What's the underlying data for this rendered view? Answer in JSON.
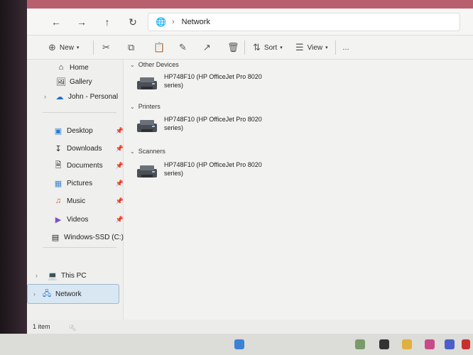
{
  "nav": {
    "back_icon": "arrow-left-icon",
    "forward_icon": "arrow-right-icon",
    "up_icon": "arrow-up-icon",
    "refresh_icon": "refresh-icon",
    "address_text": "Network"
  },
  "toolbar": {
    "new_label": "New",
    "sort_label": "Sort",
    "view_label": "View",
    "more_label": "…"
  },
  "sidebar": {
    "items": [
      {
        "label": "Home",
        "icon": "home-icon"
      },
      {
        "label": "Gallery",
        "icon": "gallery-icon"
      },
      {
        "label": "John - Personal",
        "icon": "cloud-icon"
      },
      {
        "label": "Desktop",
        "icon": "desktop-icon"
      },
      {
        "label": "Downloads",
        "icon": "download-icon"
      },
      {
        "label": "Documents",
        "icon": "documents-icon"
      },
      {
        "label": "Pictures",
        "icon": "pictures-icon"
      },
      {
        "label": "Music",
        "icon": "music-icon"
      },
      {
        "label": "Videos",
        "icon": "videos-icon"
      },
      {
        "label": "Windows-SSD (C:)",
        "icon": "drive-icon"
      },
      {
        "label": "This PC",
        "icon": "pc-icon"
      },
      {
        "label": "Network",
        "icon": "network-icon"
      }
    ]
  },
  "content": {
    "groups": [
      {
        "header": "Other Devices",
        "device": "HP748F10 (HP OfficeJet Pro 8020 series)"
      },
      {
        "header": "Printers",
        "device": "HP748F10 (HP OfficeJet Pro 8020 series)"
      },
      {
        "header": "Scanners",
        "device": "HP748F10 (HP OfficeJet Pro 8020 series)"
      }
    ]
  },
  "status": {
    "item_count": "1 item"
  },
  "colors": {
    "titlebar": "#b9606f",
    "selection": "#d9e7f3"
  }
}
